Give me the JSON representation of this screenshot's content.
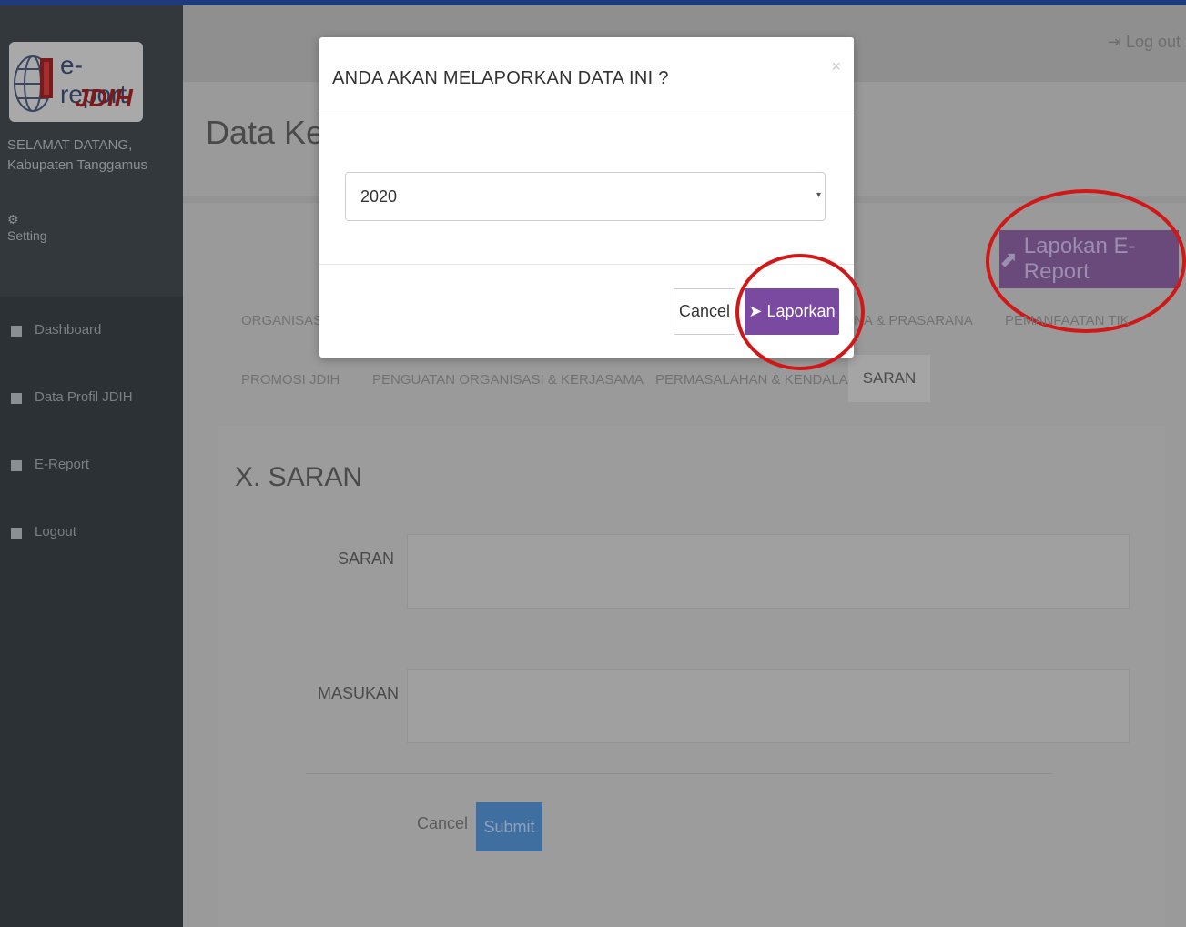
{
  "sidebar": {
    "logo_text_1": "e-report",
    "logo_text_2": "JDIH",
    "welcome_line_1": "SELAMAT DATANG,",
    "welcome_line_2": "Kabupaten Tanggamus",
    "setting_label": "Setting",
    "items": [
      {
        "label": "Dashboard"
      },
      {
        "label": "Data Profil JDIH"
      },
      {
        "label": "E-Report"
      },
      {
        "label": "Logout"
      }
    ]
  },
  "header": {
    "logout_label": "Log out"
  },
  "page": {
    "title": "Data Kean"
  },
  "toolbar": {
    "report_label": "Lapokan E-Report"
  },
  "tabs": {
    "row1": [
      "ORGANISASI",
      "NA & PRASARANA",
      "PEMANFAATAN TIK"
    ],
    "row2": [
      "PROMOSI JDIH",
      "PENGUATAN ORGANISASI & KERJASAMA",
      "PERMASALAHAN & KENDALA"
    ],
    "active": "SARAN"
  },
  "form": {
    "section_title": "X. SARAN",
    "saran_label": "SARAN",
    "masukan_label": "MASUKAN",
    "cancel_label": "Cancel",
    "submit_label": "Submit"
  },
  "modal": {
    "title": "ANDA AKAN MELAPORKAN DATA INI ?",
    "close": "×",
    "year_value": "2020",
    "cancel_label": "Cancel",
    "confirm_label": "Laporkan"
  },
  "colors": {
    "accent_purple": "#7a4aa0",
    "highlight_red": "#d01818",
    "sidebar_bg": "#2c3136"
  }
}
